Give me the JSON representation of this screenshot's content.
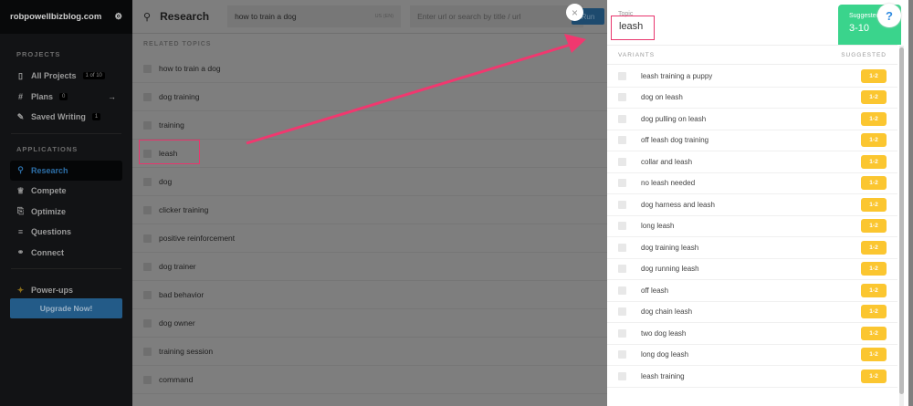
{
  "sidebar": {
    "site": "robpowellbizblog.com",
    "projects_heading": "PROJECTS",
    "items": [
      {
        "label": "All Projects",
        "badge": "1 of 10"
      },
      {
        "label": "Plans",
        "badge": "0"
      },
      {
        "label": "Saved Writing",
        "badge": "1"
      }
    ],
    "applications_heading": "APPLICATIONS",
    "apps": [
      {
        "label": "Research"
      },
      {
        "label": "Compete"
      },
      {
        "label": "Optimize"
      },
      {
        "label": "Questions"
      },
      {
        "label": "Connect"
      }
    ],
    "powerups": "Power-ups",
    "upgrade": "Upgrade Now!"
  },
  "main": {
    "title": "Research",
    "query": "how to train a dog",
    "locale": "US (EN)",
    "url_placeholder": "Enter url or search by title / url",
    "run": "Run",
    "related_heading": "RELATED TOPICS",
    "topics": [
      "how to train a dog",
      "dog training",
      "training",
      "leash",
      "dog",
      "clicker training",
      "positive reinforcement",
      "dog trainer",
      "bad behavior",
      "dog owner",
      "training session",
      "command"
    ]
  },
  "panel": {
    "topic_label": "Topic",
    "topic": "leash",
    "suggested_label": "Suggested",
    "suggested_range": "3-10",
    "help": "?",
    "variants_heading": "VARIANTS",
    "suggested_heading": "SUGGESTED",
    "variants": [
      {
        "name": "leash training a puppy",
        "s": "1-2"
      },
      {
        "name": "dog on leash",
        "s": "1-2"
      },
      {
        "name": "dog pulling on leash",
        "s": "1-2"
      },
      {
        "name": "off leash dog training",
        "s": "1-2"
      },
      {
        "name": "collar and leash",
        "s": "1-2"
      },
      {
        "name": "no leash needed",
        "s": "1-2"
      },
      {
        "name": "dog harness and leash",
        "s": "1-2"
      },
      {
        "name": "long leash",
        "s": "1-2"
      },
      {
        "name": "dog training leash",
        "s": "1-2"
      },
      {
        "name": "dog running leash",
        "s": "1-2"
      },
      {
        "name": "off leash",
        "s": "1-2"
      },
      {
        "name": "dog chain leash",
        "s": "1-2"
      },
      {
        "name": "two dog leash",
        "s": "1-2"
      },
      {
        "name": "long dog leash",
        "s": "1-2"
      },
      {
        "name": "leash training",
        "s": "1-2"
      }
    ]
  },
  "close": "×",
  "colors": {
    "highlight": "#e8356d",
    "green": "#3ad48c",
    "pill": "#fbc630"
  }
}
